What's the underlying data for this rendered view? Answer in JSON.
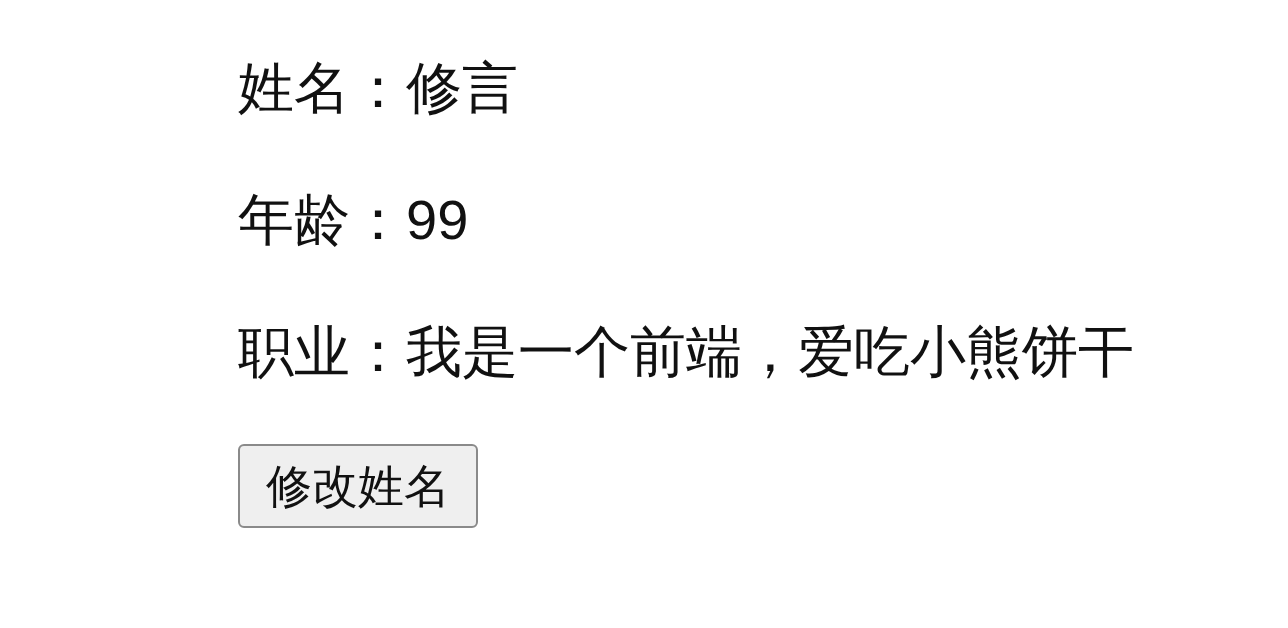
{
  "fields": [
    {
      "label": "姓名：",
      "value": "修言"
    },
    {
      "label": "年龄：",
      "value": "99"
    },
    {
      "label": "职业：",
      "value": "我是一个前端，爱吃小熊饼干"
    }
  ],
  "button": {
    "label": "修改姓名"
  }
}
